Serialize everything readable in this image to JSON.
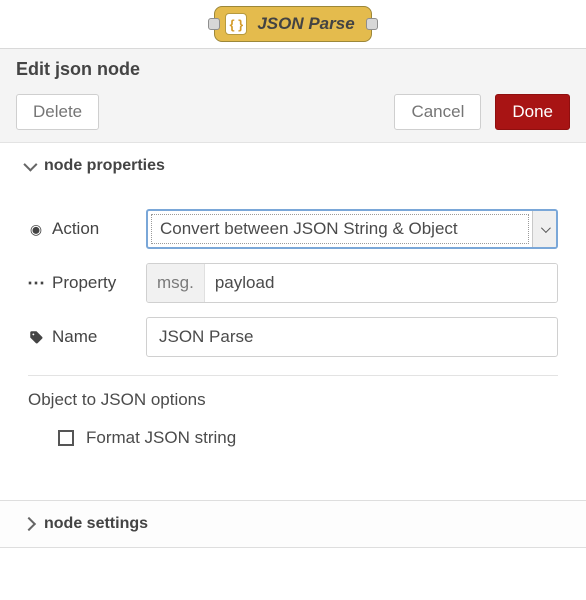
{
  "canvas": {
    "node_label": "JSON Parse",
    "node_icon_text": "{ }"
  },
  "editor": {
    "title": "Edit json node",
    "buttons": {
      "delete": "Delete",
      "cancel": "Cancel",
      "done": "Done"
    },
    "sections": {
      "properties": {
        "title": "node properties",
        "expanded": true
      },
      "settings": {
        "title": "node settings",
        "expanded": false
      }
    },
    "form": {
      "action": {
        "label": "Action",
        "value": "Convert between JSON String & Object"
      },
      "property": {
        "label": "Property",
        "prefix": "msg.",
        "value": "payload"
      },
      "name": {
        "label": "Name",
        "value": "JSON Parse"
      }
    },
    "object_to_json": {
      "title": "Object to JSON options",
      "format_label": "Format JSON string",
      "format_checked": false
    }
  }
}
